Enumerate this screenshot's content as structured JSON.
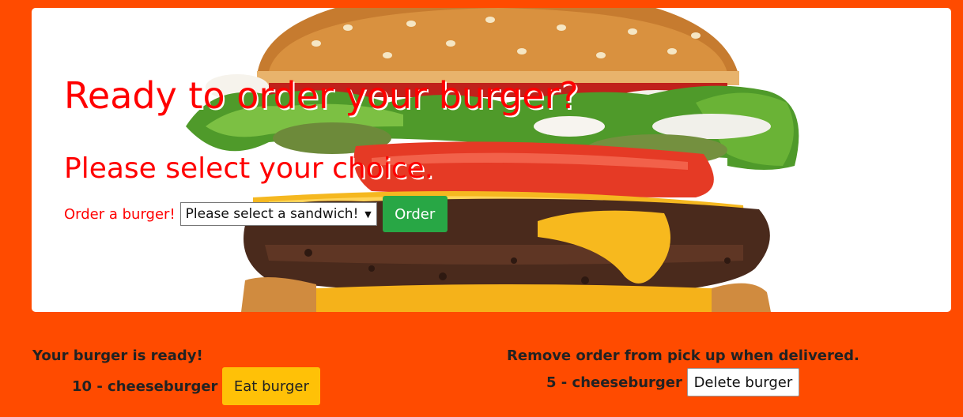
{
  "hero": {
    "title": "Ready to order your burger?",
    "subtitle": "Please select your choice.",
    "order_label": "Order a burger!",
    "select_value": "Please select a sandwich!",
    "order_button": "Order"
  },
  "ready": {
    "heading": "Your burger is ready!",
    "items": [
      {
        "label": "10 - cheeseburger",
        "button": "Eat burger"
      }
    ]
  },
  "pickup": {
    "heading": "Remove order from pick up when delivered.",
    "items": [
      {
        "label": "5 - cheeseburger",
        "button": "Delete burger"
      }
    ]
  },
  "colors": {
    "page_background": "#ff4b00",
    "title_red": "#ff0000",
    "order_green": "#28a745",
    "eat_yellow": "#ffc107"
  },
  "icons": {
    "hero_image": "cheeseburger-photo",
    "select_arrow": "dropdown-arrow-icon"
  }
}
